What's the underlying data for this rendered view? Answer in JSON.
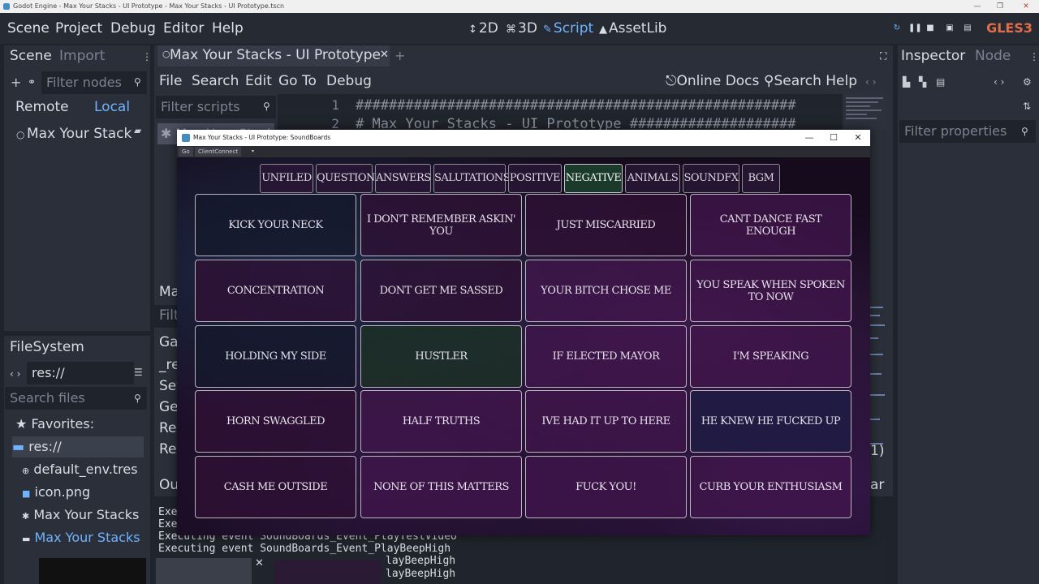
{
  "os_window": {
    "title": "Godot Engine - Max Your Stacks - UI Prototype - Max Your Stacks - UI Prototype.tscn"
  },
  "menubar": {
    "items": [
      "Scene",
      "Project",
      "Debug",
      "Editor",
      "Help"
    ],
    "workspaces": [
      {
        "label": "2D",
        "icon": "2d-icon",
        "active": false
      },
      {
        "label": "3D",
        "icon": "3d-icon",
        "active": false
      },
      {
        "label": "Script",
        "icon": "script-icon",
        "active": true
      },
      {
        "label": "AssetLib",
        "icon": "assetlib-icon",
        "active": false
      }
    ],
    "renderer": "GLES3",
    "accent_color": "#e26d4a"
  },
  "scene_dock": {
    "tabs": [
      "Scene",
      "Import"
    ],
    "filter_placeholder": "Filter nodes",
    "remote_label": "Remote",
    "local_label": "Local",
    "root_node": "Max Your Stack"
  },
  "filesystem_dock": {
    "title": "FileSystem",
    "path": "res://",
    "search_placeholder": "Search files",
    "items": [
      {
        "label": "Favorites:",
        "icon": "star-icon"
      },
      {
        "label": "res://",
        "icon": "folder-icon"
      },
      {
        "label": "default_env.tres",
        "icon": "resource-icon"
      },
      {
        "label": "icon.png",
        "icon": "image-icon"
      },
      {
        "label": "Max Your Stacks",
        "icon": "gear-icon"
      },
      {
        "label": "Max Your Stacks",
        "icon": "scene-icon"
      }
    ]
  },
  "script_editor": {
    "tab_title": "Max Your Stacks - UI Prototype",
    "menu": [
      "File",
      "Search",
      "Edit",
      "Go To",
      "Debug"
    ],
    "online_docs": "Online Docs",
    "search_help": "Search Help",
    "filter_scripts_placeholder": "Filter scripts",
    "script_list_item": "Max Your Stack",
    "lines": [
      {
        "num": "1",
        "text": "#####################################################"
      },
      {
        "num": "2",
        "text": "# Max Your Stacks - UI Prototype ####################"
      }
    ],
    "side_partial": [
      "Ma",
      "Filt",
      "Ga",
      "_re",
      "Set",
      "Ge",
      "Rea",
      "Rel",
      "Ou"
    ],
    "right_partial": [
      "1)",
      "ar"
    ]
  },
  "inspector": {
    "tabs": [
      "Inspector",
      "Node"
    ],
    "filter_placeholder": "Filter properties"
  },
  "output": {
    "lines": [
      "Exe",
      "Exe",
      "Exe",
      "Executing event SoundBoards_Event_PlayTestVideo",
      "Executing event SoundBoards_Event_PlayBeepHigh",
      "layBeepHigh",
      "layBeepHigh"
    ]
  },
  "game_window": {
    "title": "Max Your Stacks - UI Prototype: SoundBoards",
    "menu": [
      "Go",
      "ClientConnect"
    ],
    "categories": [
      {
        "label": "UNFILED",
        "active": false
      },
      {
        "label": "QUESTIONS",
        "active": false
      },
      {
        "label": "ANSWERS",
        "active": false
      },
      {
        "label": "SALUTATIONS",
        "active": false
      },
      {
        "label": "POSITIVE",
        "active": false
      },
      {
        "label": "NEGATIVE",
        "active": true
      },
      {
        "label": "ANIMALS",
        "active": false
      },
      {
        "label": "SOUNDFX",
        "active": false
      },
      {
        "label": "BGM",
        "active": false
      }
    ],
    "buttons": [
      {
        "label": "KICK YOUR NECK",
        "tone": "a"
      },
      {
        "label": "I DON'T REMEMBER ASKIN' YOU",
        "tone": "b"
      },
      {
        "label": "JUST MISCARRIED",
        "tone": "b"
      },
      {
        "label": "CANT DANCE FAST ENOUGH",
        "tone": "c"
      },
      {
        "label": "CONCENTRATION",
        "tone": "b"
      },
      {
        "label": "DONT GET ME SASSED",
        "tone": "b"
      },
      {
        "label": "YOUR BITCH CHOSE ME",
        "tone": "c"
      },
      {
        "label": "YOU SPEAK WHEN SPOKEN TO NOW",
        "tone": "c"
      },
      {
        "label": "HOLDING MY SIDE",
        "tone": "a"
      },
      {
        "label": "HUSTLER",
        "tone": "g"
      },
      {
        "label": "IF ELECTED MAYOR",
        "tone": "c"
      },
      {
        "label": "I'M SPEAKING",
        "tone": "c"
      },
      {
        "label": "HORN SWAGGLED",
        "tone": "b"
      },
      {
        "label": "HALF TRUTHS",
        "tone": "c"
      },
      {
        "label": "IVE HAD IT UP TO HERE",
        "tone": "c"
      },
      {
        "label": "HE KNEW HE FUCKED UP",
        "tone": "n"
      },
      {
        "label": "CASH ME OUTSIDE",
        "tone": "b"
      },
      {
        "label": "NONE OF THIS MATTERS",
        "tone": "c"
      },
      {
        "label": "FUCK YOU!",
        "tone": "c"
      },
      {
        "label": "CURB YOUR ENTHUSIASM",
        "tone": "c"
      }
    ]
  }
}
